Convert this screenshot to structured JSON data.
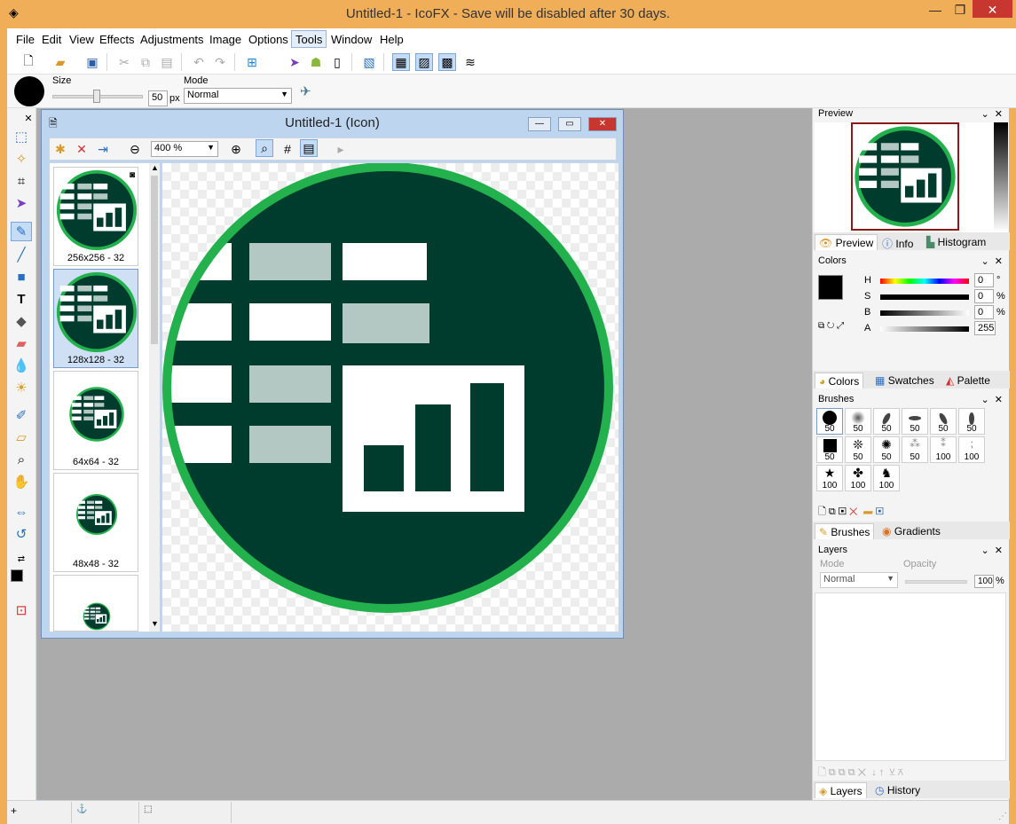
{
  "window": {
    "title": "Untitled-1 - IcoFX - Save will be disabled after 30 days."
  },
  "menu": [
    "File",
    "Edit",
    "View",
    "Effects",
    "Adjustments",
    "Image",
    "Options",
    "Tools",
    "Window",
    "Help"
  ],
  "options": {
    "size_label": "Size",
    "size_value": "50",
    "size_unit": "px",
    "mode_label": "Mode",
    "mode_value": "Normal"
  },
  "document": {
    "title": "Untitled-1 (Icon)",
    "zoom": "400 %",
    "thumbs": [
      "256x256 - 32",
      "128x128 - 32",
      "64x64 - 32",
      "48x48 - 32"
    ],
    "selected_thumb": 1
  },
  "icon_colors": {
    "ring": "#22b14c",
    "fill": "#003c2d",
    "white": "#ffffff",
    "gray": "#b4c8c3"
  },
  "panels": {
    "preview": {
      "title": "Preview",
      "tabs": [
        "Preview",
        "Info",
        "Histogram"
      ]
    },
    "colors": {
      "title": "Colors",
      "labels": [
        "H",
        "S",
        "B",
        "A"
      ],
      "values": [
        "0",
        "0",
        "0",
        "255"
      ],
      "units": [
        "°",
        "%",
        "%"
      ],
      "tabs": [
        "Colors",
        "Swatches",
        "Palette"
      ]
    },
    "brushes": {
      "title": "Brushes",
      "sizes": [
        "50",
        "50",
        "50",
        "50",
        "50",
        "50",
        "50",
        "50",
        "50",
        "50",
        "100",
        "100",
        "100",
        "100",
        "100"
      ],
      "tabs": [
        "Brushes",
        "Gradients"
      ]
    },
    "layers": {
      "title": "Layers",
      "mode_label": "Mode",
      "opacity_label": "Opacity",
      "mode_value": "Normal",
      "opacity_value": "100",
      "opacity_unit": "%",
      "tabs": [
        "Layers",
        "History"
      ]
    }
  }
}
